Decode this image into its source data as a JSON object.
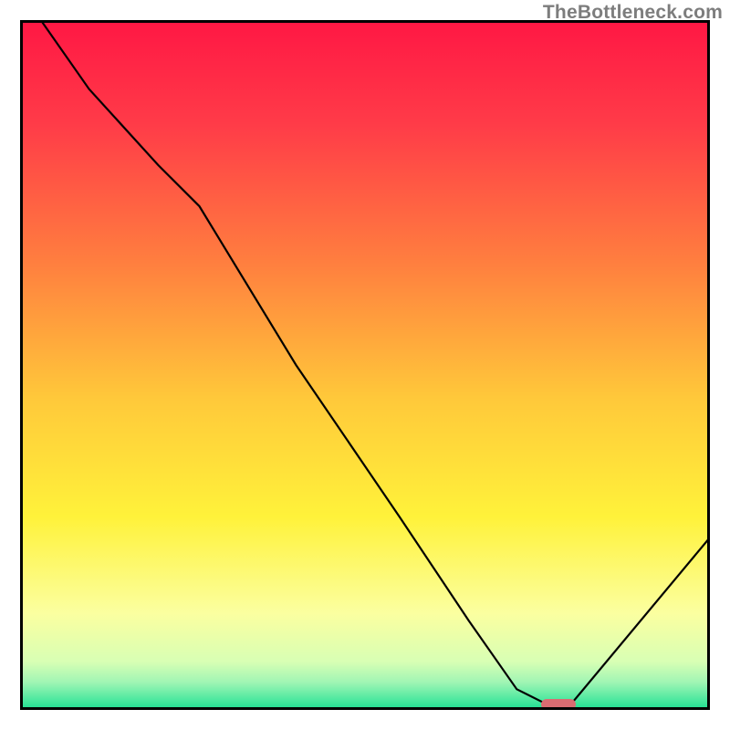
{
  "watermark": "TheBottleneck.com",
  "chart_data": {
    "type": "line",
    "title": "",
    "xlabel": "",
    "ylabel": "",
    "xlim": [
      0,
      100
    ],
    "ylim": [
      0,
      100
    ],
    "grid": false,
    "legend": false,
    "series": [
      {
        "name": "bottleneck-curve",
        "x": [
          3,
          10,
          20,
          26,
          40,
          55,
          65,
          72,
          76,
          80,
          100
        ],
        "y": [
          100,
          90,
          79,
          73,
          50,
          28,
          13,
          3,
          1,
          1,
          25
        ]
      }
    ],
    "marker": {
      "name": "optimal-marker",
      "x_center": 78,
      "width_frac": 5,
      "height_frac": 1.6,
      "color": "#da6c72"
    },
    "gradient_stops": [
      {
        "offset": 0,
        "color": "#ff1744"
      },
      {
        "offset": 15,
        "color": "#ff3b48"
      },
      {
        "offset": 35,
        "color": "#ff7e3f"
      },
      {
        "offset": 55,
        "color": "#ffc93a"
      },
      {
        "offset": 72,
        "color": "#fff23a"
      },
      {
        "offset": 86,
        "color": "#fbffa0"
      },
      {
        "offset": 93,
        "color": "#d8ffb4"
      },
      {
        "offset": 96,
        "color": "#a0f5b4"
      },
      {
        "offset": 98.5,
        "color": "#4de8a0"
      },
      {
        "offset": 100,
        "color": "#1bdc90"
      }
    ]
  }
}
